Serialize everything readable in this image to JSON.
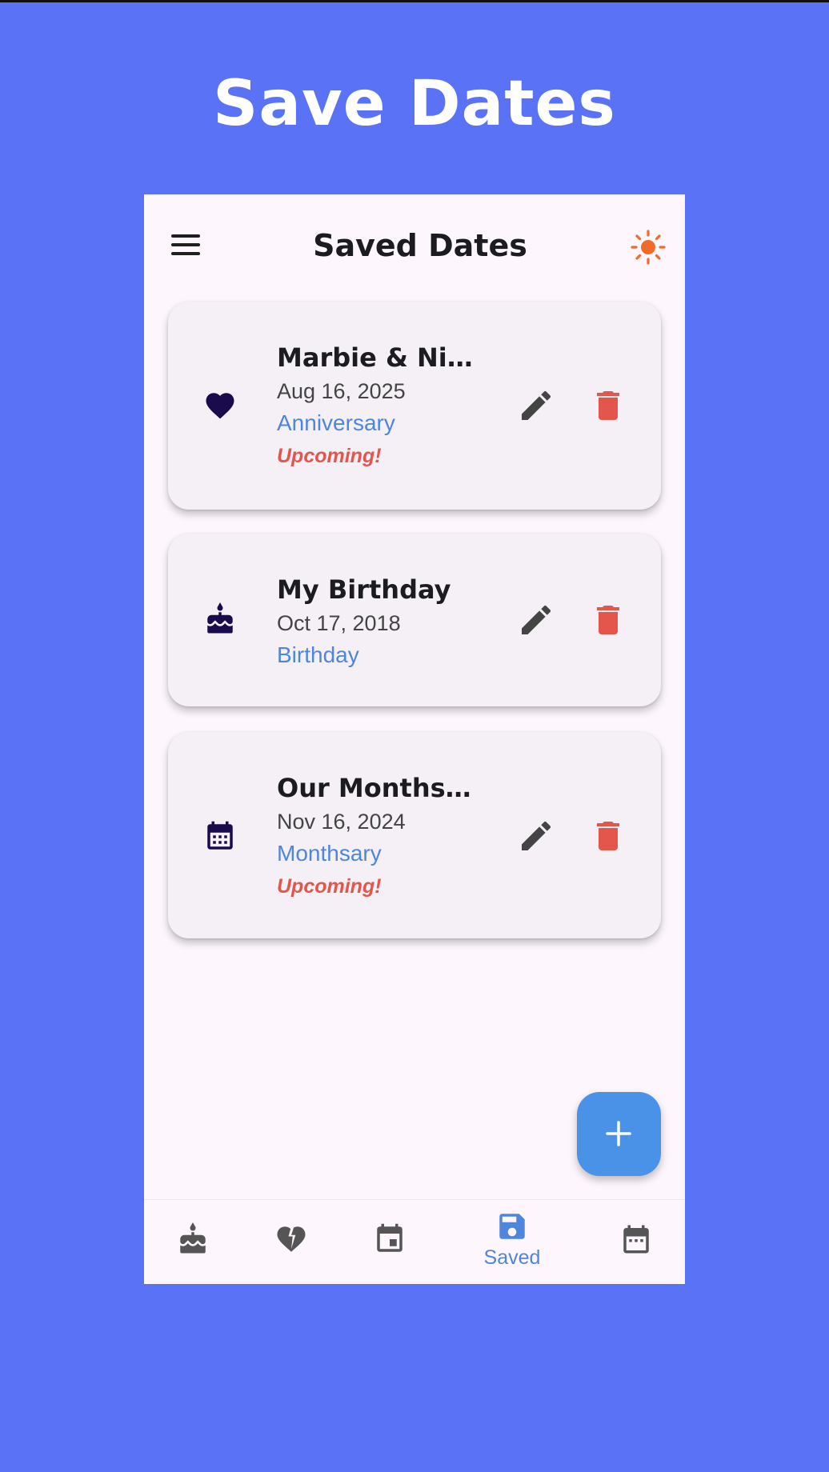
{
  "promo": {
    "title": "Save Dates"
  },
  "appbar": {
    "title": "Saved Dates",
    "menu_icon": "menu-icon",
    "theme_icon": "sun-icon"
  },
  "colors": {
    "background": "#5a72f5",
    "accent": "#4a92e8",
    "type_blue": "#4f86dc",
    "danger": "#e4554b",
    "icon_dark": "#1a0b4d",
    "theme_orange": "#f06a2a"
  },
  "dates": [
    {
      "name": "Marbie & Nik…",
      "date": "Aug 16, 2025",
      "type": "Anniversary",
      "status": "Upcoming!",
      "icon": "heart-icon"
    },
    {
      "name": "My Birthday",
      "date": "Oct 17, 2018",
      "type": "Birthday",
      "status": "",
      "icon": "cake-icon"
    },
    {
      "name": "Our Monthsary",
      "date": "Nov 16, 2024",
      "type": "Monthsary",
      "status": "Upcoming!",
      "icon": "calendar-icon"
    }
  ],
  "fab": {
    "icon": "plus-icon"
  },
  "bottom_nav": {
    "items": [
      {
        "icon": "cake-icon",
        "label": ""
      },
      {
        "icon": "broken-heart-icon",
        "label": ""
      },
      {
        "icon": "calendar-event-icon",
        "label": ""
      },
      {
        "icon": "save-icon",
        "label": "Saved",
        "active": true
      },
      {
        "icon": "calendar-icon",
        "label": ""
      }
    ]
  }
}
